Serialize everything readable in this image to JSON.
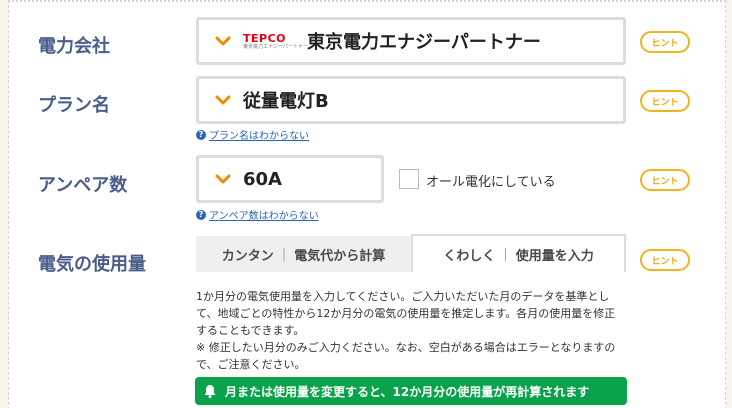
{
  "company": {
    "label": "電力会社",
    "selected": "東京電力エナジーパートナー",
    "logo_text": "TEPCO",
    "logo_sub": "東京電力エナジーパートナー"
  },
  "plan": {
    "label": "プラン名",
    "selected": "従量電灯B",
    "help_link": "プラン名はわからない"
  },
  "ampere": {
    "label": "アンペア数",
    "selected": "60A",
    "help_link": "アンペア数はわからない",
    "all_electric_label": "オール電化にしている",
    "all_electric_checked": false
  },
  "usage": {
    "label": "電気の使用量",
    "tabs": [
      {
        "part1": "カンタン",
        "part2": "電気代から計算",
        "active": false
      },
      {
        "part1": "くわしく",
        "part2": "使用量を入力",
        "active": true
      }
    ],
    "description_1": "1か月分の電気使用量を入力してください。ご入力いただいた月のデータを基準として、地域ごとの特性から12か月分の電気の使用量を推定します。各月の使用量を修正することもできます。",
    "description_2": "※ 修正したい月分のみご入力ください。なお、空白がある場合はエラーとなりますので、ご注意ください。",
    "notice": "月または使用量を変更すると、12か月分の使用量が再計算されます"
  },
  "hint_label": "ヒント",
  "help_icon": "?",
  "colors": {
    "label": "#4a5d8a",
    "hint": "#f2b31d",
    "chevron": "#f08a00",
    "notice": "#0aa24a",
    "link": "#2a64b8"
  }
}
